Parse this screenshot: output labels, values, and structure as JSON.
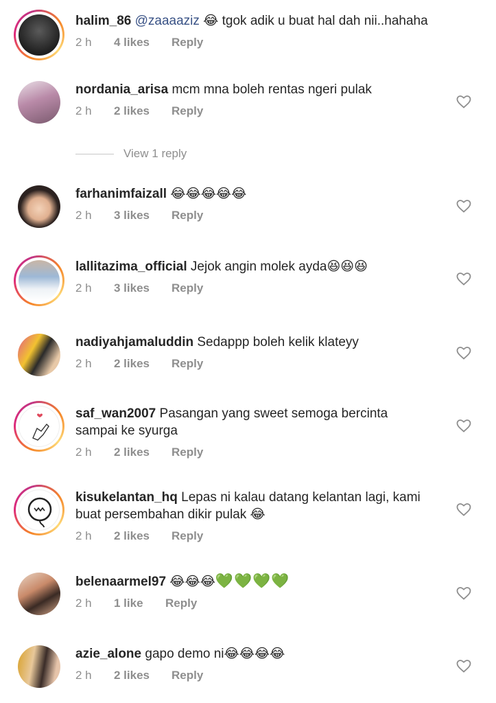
{
  "heart_icon": "heart-outline-icon",
  "colors": {
    "text": "#262626",
    "meta": "#8e8e8e",
    "mention": "#385185",
    "heart_green": "#59c135"
  },
  "comments": [
    {
      "username": "halim_86",
      "mention": "@zaaaaziz",
      "text": " 😂 tgok adik u buat hal dah nii..hahaha",
      "text2": "",
      "time": "2 h",
      "likes": "4 likes",
      "reply": "Reply"
    },
    {
      "username": "nordania_arisa",
      "mention": "",
      "text": " mcm mna boleh rentas ngeri pulak",
      "text2": "",
      "time": "2 h",
      "likes": "2 likes",
      "reply": "Reply"
    },
    {
      "username": "farhanimfaizall",
      "mention": "",
      "text": " 😂😂😂😂😂",
      "text2": "",
      "time": "2 h",
      "likes": "3 likes",
      "reply": "Reply"
    },
    {
      "username": "lallitazima_official",
      "mention": "",
      "text": " Jejok angin molek ayda😆😆😆",
      "text2": "",
      "time": "2 h",
      "likes": "3 likes",
      "reply": "Reply"
    },
    {
      "username": "nadiyahjamaluddin",
      "mention": "",
      "text": " Sedappp boleh kelik klateyy",
      "text2": "",
      "time": "2 h",
      "likes": "2 likes",
      "reply": "Reply"
    },
    {
      "username": "saf_wan2007",
      "mention": "",
      "text": " Pasangan yang sweet semoga bercinta",
      "text2": "sampai ke syurga",
      "time": "2 h",
      "likes": "2 likes",
      "reply": "Reply"
    },
    {
      "username": "kisukelantan_hq",
      "mention": "",
      "text": " Lepas ni kalau datang kelantan lagi, kami",
      "text2": "buat persembahan dikir pulak 😂",
      "time": "2 h",
      "likes": "2 likes",
      "reply": "Reply"
    },
    {
      "username": "belenaarmel97",
      "mention": "",
      "text": " 😂😂😂",
      "text_green": "💚💚💚💚",
      "text2": "",
      "time": "2 h",
      "likes": "1 like",
      "reply": "Reply"
    },
    {
      "username": "azie_alone",
      "mention": "",
      "text": " gapo demo ni😂😂😂😂",
      "text2": "",
      "time": "2 h",
      "likes": "2 likes",
      "reply": "Reply"
    }
  ],
  "view_replies": "View 1 reply"
}
